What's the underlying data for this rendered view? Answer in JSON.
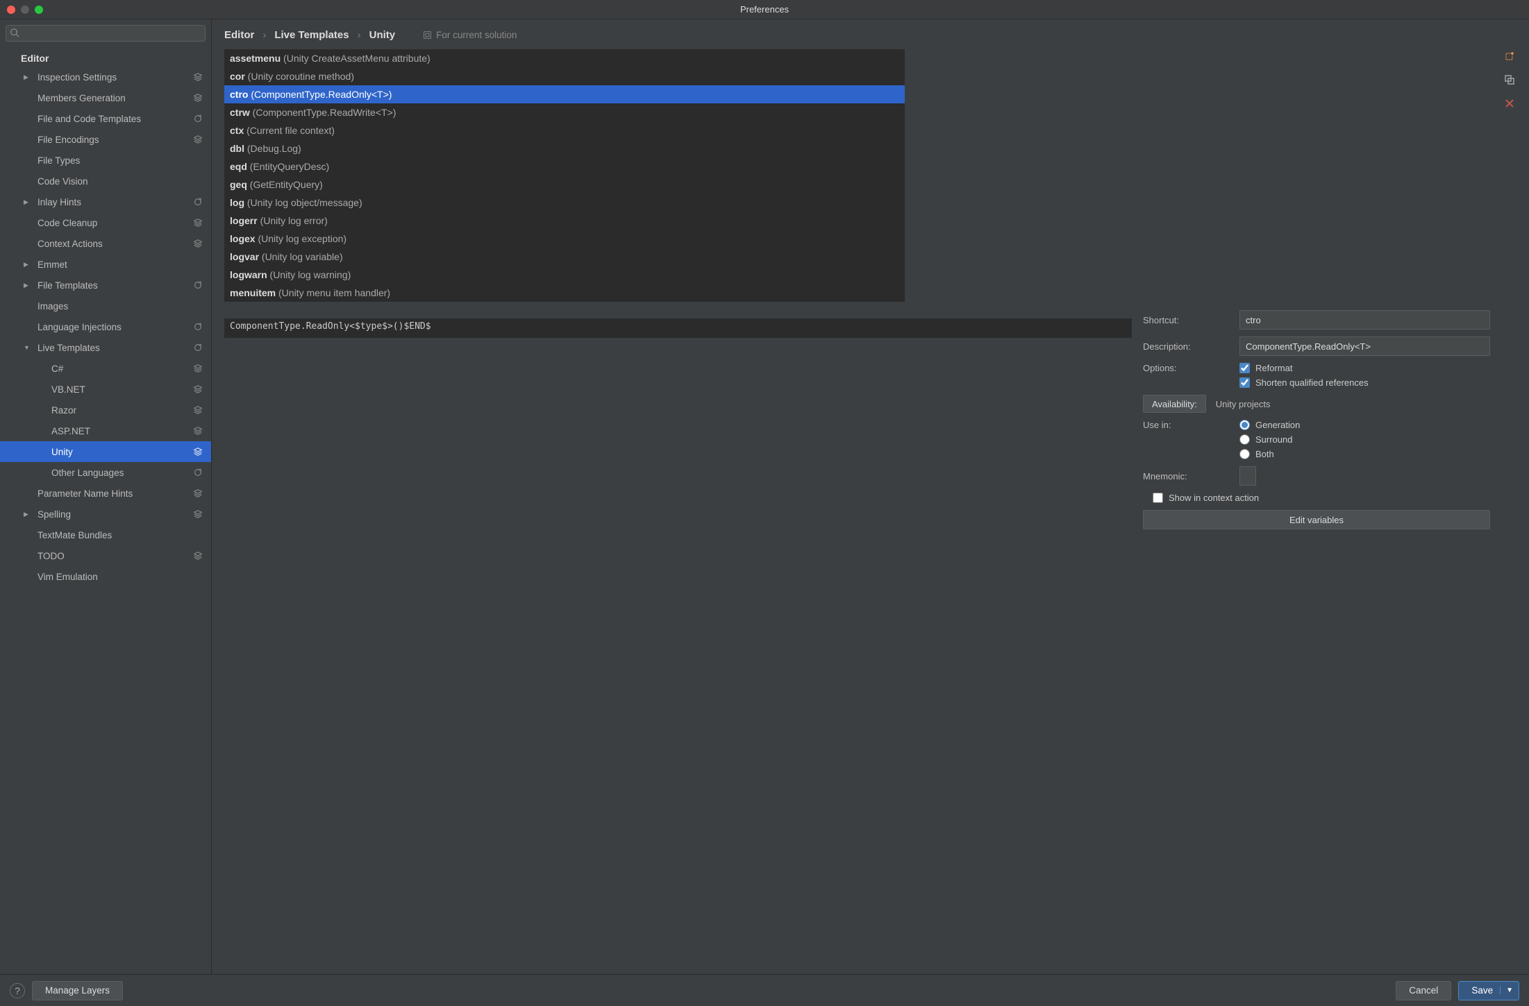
{
  "window": {
    "title": "Preferences"
  },
  "breadcrumbs": [
    "Editor",
    "Live Templates",
    "Unity"
  ],
  "scope_label": "For current solution",
  "sidebar": {
    "heading": "Editor",
    "items": [
      {
        "label": "Inspection Settings",
        "level": 0,
        "expand": "closed",
        "badge": "layers"
      },
      {
        "label": "Members Generation",
        "level": 1,
        "badge": "layers"
      },
      {
        "label": "File and Code Templates",
        "level": 1,
        "badge": "restore"
      },
      {
        "label": "File Encodings",
        "level": 1,
        "badge": "layers"
      },
      {
        "label": "File Types",
        "level": 1
      },
      {
        "label": "Code Vision",
        "level": 1
      },
      {
        "label": "Inlay Hints",
        "level": 0,
        "expand": "closed",
        "badge": "restore"
      },
      {
        "label": "Code Cleanup",
        "level": 1,
        "badge": "layers"
      },
      {
        "label": "Context Actions",
        "level": 1,
        "badge": "layers"
      },
      {
        "label": "Emmet",
        "level": 0,
        "expand": "closed"
      },
      {
        "label": "File Templates",
        "level": 0,
        "expand": "closed",
        "badge": "restore"
      },
      {
        "label": "Images",
        "level": 1
      },
      {
        "label": "Language Injections",
        "level": 1,
        "badge": "restore"
      },
      {
        "label": "Live Templates",
        "level": 0,
        "expand": "open",
        "badge": "restore"
      },
      {
        "label": "C#",
        "level": 2,
        "badge": "layers"
      },
      {
        "label": "VB.NET",
        "level": 2,
        "badge": "layers"
      },
      {
        "label": "Razor",
        "level": 2,
        "badge": "layers"
      },
      {
        "label": "ASP.NET",
        "level": 2,
        "badge": "layers"
      },
      {
        "label": "Unity",
        "level": 2,
        "badge": "layers",
        "selected": true
      },
      {
        "label": "Other Languages",
        "level": 2,
        "badge": "restore"
      },
      {
        "label": "Parameter Name Hints",
        "level": 1,
        "badge": "layers"
      },
      {
        "label": "Spelling",
        "level": 0,
        "expand": "closed",
        "badge": "layers"
      },
      {
        "label": "TextMate Bundles",
        "level": 1
      },
      {
        "label": "TODO",
        "level": 1,
        "badge": "layers"
      },
      {
        "label": "Vim Emulation",
        "level": 1
      }
    ]
  },
  "templates": [
    {
      "abbr": "assetmenu",
      "desc": "(Unity CreateAssetMenu attribute)"
    },
    {
      "abbr": "cor",
      "desc": "(Unity coroutine method)"
    },
    {
      "abbr": "ctro",
      "desc": "(ComponentType.ReadOnly<T>)",
      "selected": true
    },
    {
      "abbr": "ctrw",
      "desc": "(ComponentType.ReadWrite<T>)"
    },
    {
      "abbr": "ctx",
      "desc": "(Current file context)"
    },
    {
      "abbr": "dbl",
      "desc": "(Debug.Log)"
    },
    {
      "abbr": "eqd",
      "desc": "(EntityQueryDesc)"
    },
    {
      "abbr": "geq",
      "desc": "(GetEntityQuery)"
    },
    {
      "abbr": "log",
      "desc": "(Unity log object/message)"
    },
    {
      "abbr": "logerr",
      "desc": "(Unity log error)"
    },
    {
      "abbr": "logex",
      "desc": "(Unity log exception)"
    },
    {
      "abbr": "logvar",
      "desc": "(Unity log variable)"
    },
    {
      "abbr": "logwarn",
      "desc": "(Unity log warning)"
    },
    {
      "abbr": "menuitem",
      "desc": "(Unity menu item handler)"
    }
  ],
  "code": "ComponentType.ReadOnly<$type$>()$END$",
  "props": {
    "shortcut_label": "Shortcut:",
    "shortcut_value": "ctro",
    "description_label": "Description:",
    "description_value": "ComponentType.ReadOnly<T>",
    "options_label": "Options:",
    "opt_reformat": "Reformat",
    "opt_shorten": "Shorten qualified references",
    "availability_btn": "Availability:",
    "availability_value": "Unity projects",
    "usein_label": "Use in:",
    "usein_generation": "Generation",
    "usein_surround": "Surround",
    "usein_both": "Both",
    "mnemonic_label": "Mnemonic:",
    "show_context_action": "Show in context action",
    "edit_variables": "Edit variables"
  },
  "footer": {
    "manage_layers": "Manage Layers",
    "cancel": "Cancel",
    "save": "Save"
  }
}
